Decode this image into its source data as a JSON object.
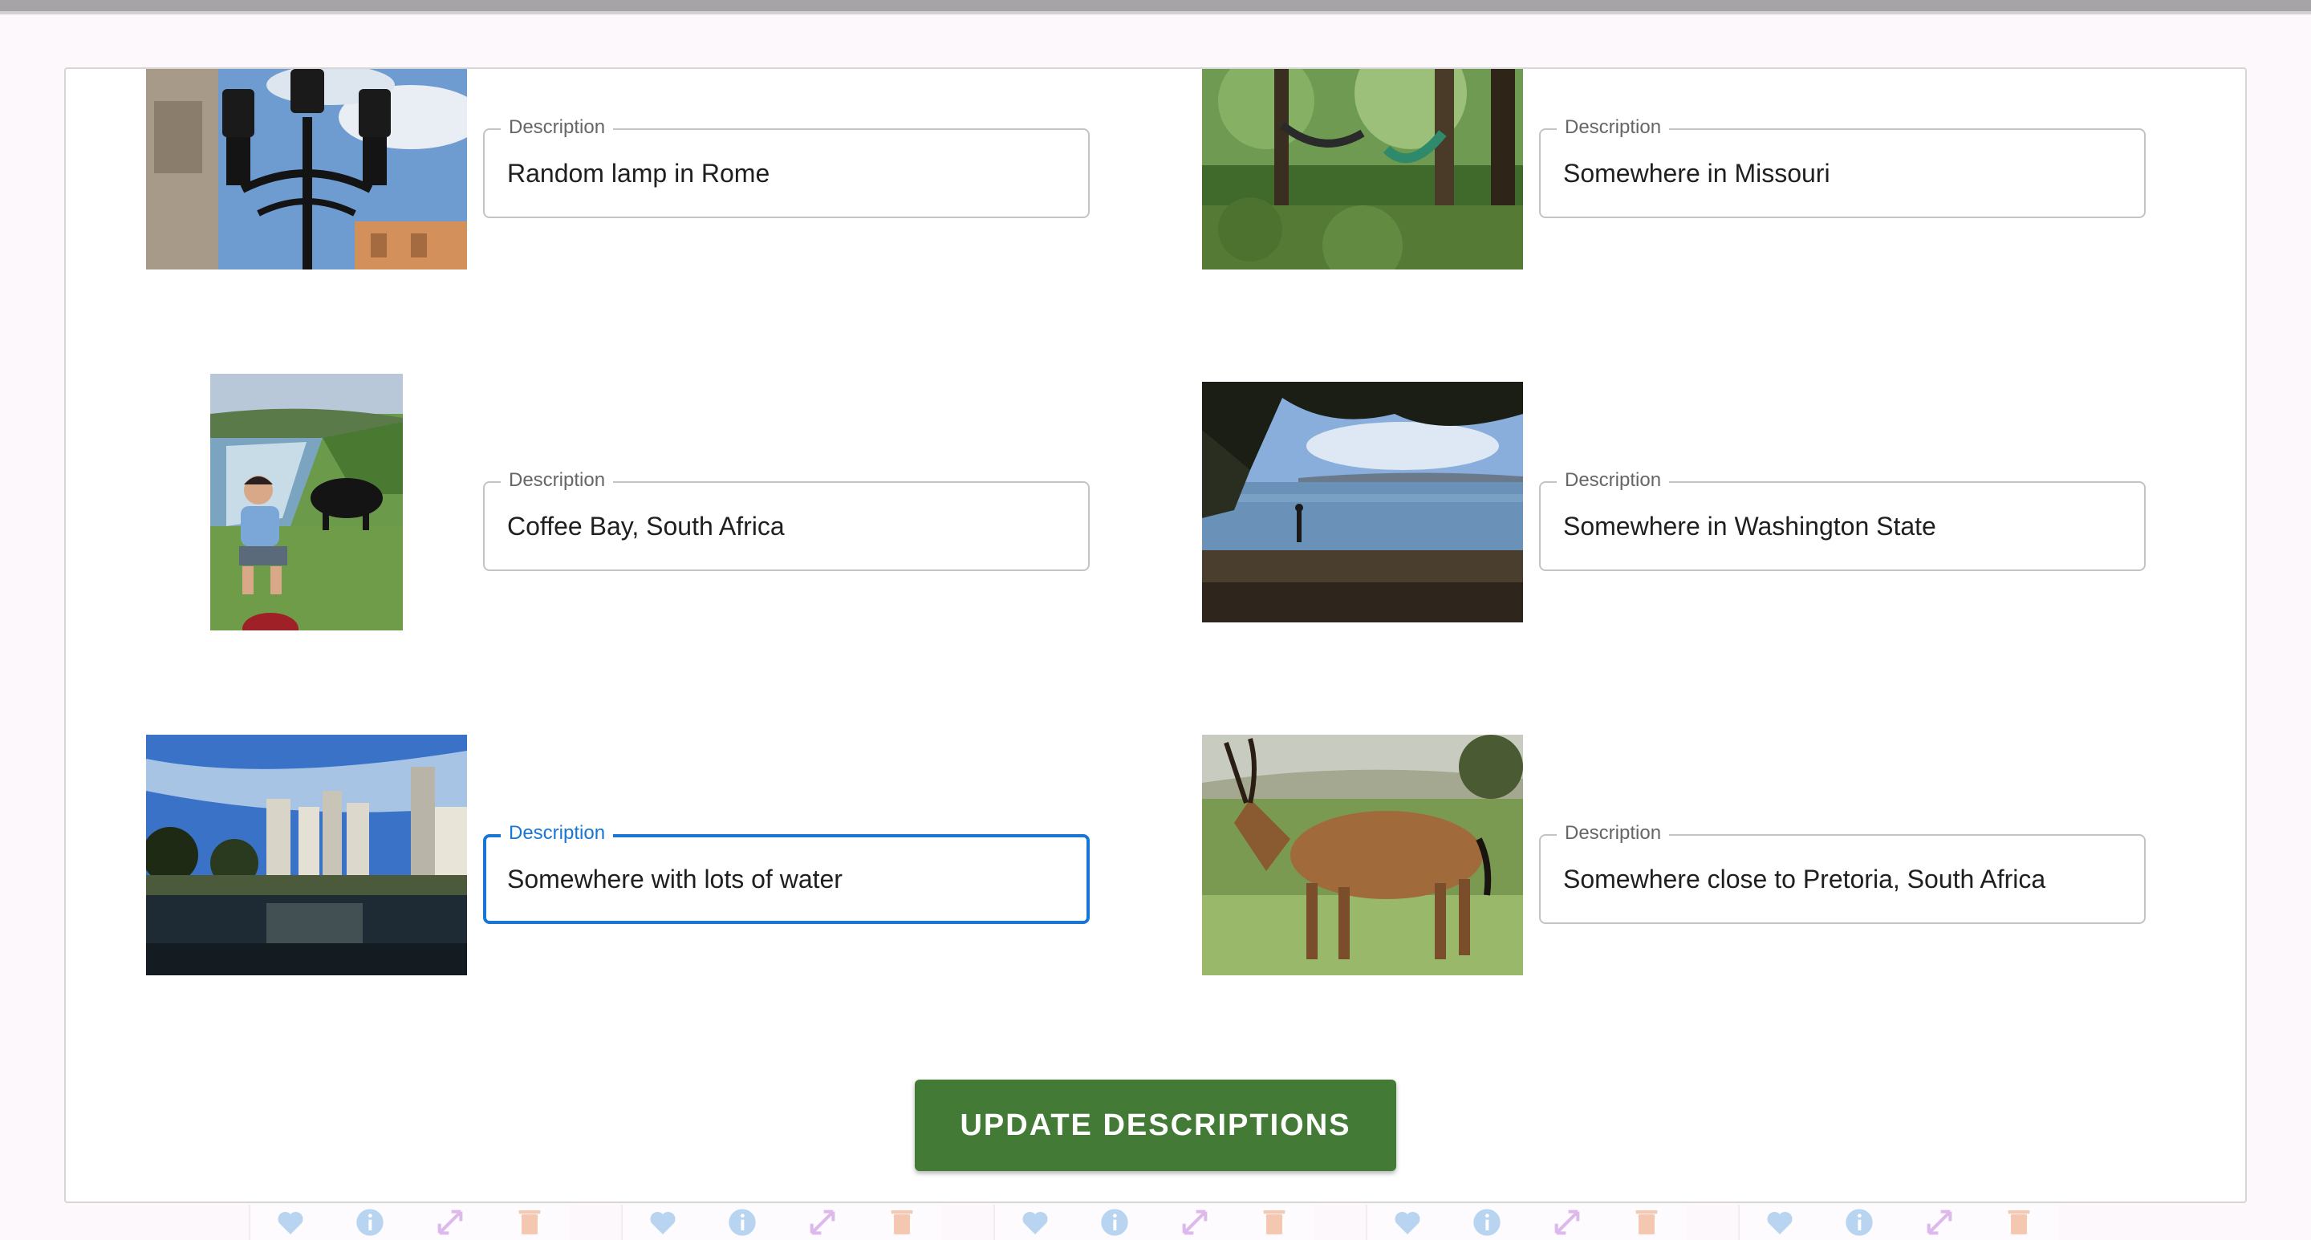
{
  "items": [
    {
      "label": "Description",
      "value": "Random lamp in Rome",
      "focused": false
    },
    {
      "label": "Description",
      "value": "Somewhere in Missouri",
      "focused": false
    },
    {
      "label": "Description",
      "value": "Coffee Bay, South Africa",
      "focused": false
    },
    {
      "label": "Description",
      "value": "Somewhere in Washington State",
      "focused": false
    },
    {
      "label": "Description",
      "value": "Somewhere with lots of water",
      "focused": true
    },
    {
      "label": "Description",
      "value": "Somewhere close to Pretoria, South Africa",
      "focused": false
    }
  ],
  "update_button_label": "UPDATE DESCRIPTIONS",
  "tray_icons": [
    "heart-icon",
    "info-icon",
    "expand-icon",
    "trash-icon"
  ],
  "colors": {
    "accent": "#1976d2",
    "button": "#437a36",
    "heart": "#b8d4f0",
    "info": "#b8d4f0",
    "expand": "#dcb8ec",
    "trash": "#f4c8b0"
  }
}
